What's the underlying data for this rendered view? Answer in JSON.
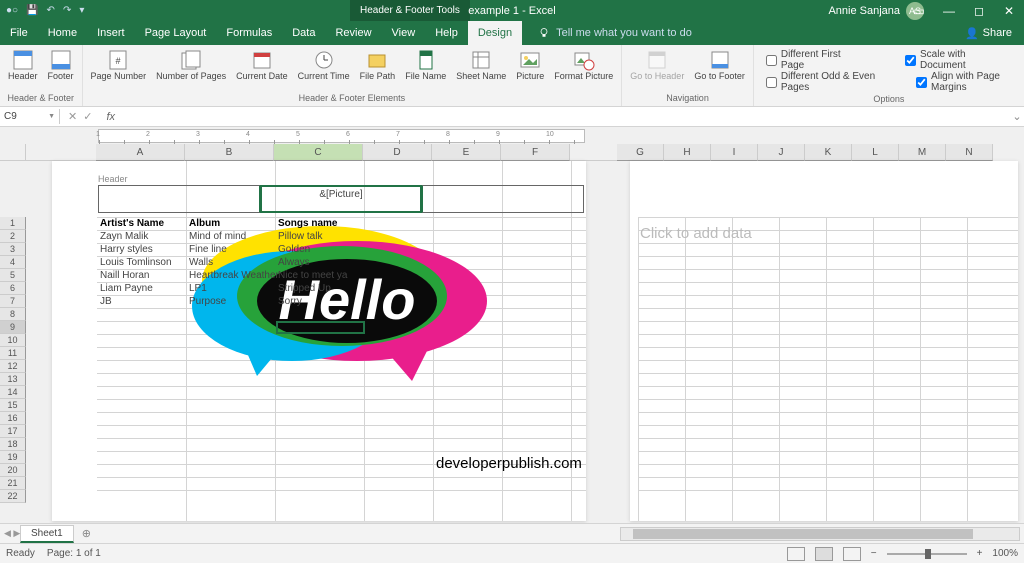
{
  "title": "example 1 - Excel",
  "contextual_tab": "Header & Footer Tools",
  "user": {
    "name": "Annie Sanjana",
    "initials": "AS"
  },
  "menu": [
    "File",
    "Home",
    "Insert",
    "Page Layout",
    "Formulas",
    "Data",
    "Review",
    "View",
    "Help",
    "Design"
  ],
  "active_menu": "Design",
  "tellme": "Tell me what you want to do",
  "share": "Share",
  "ribbon": {
    "g1": {
      "buttons": [
        "Header",
        "Footer"
      ],
      "label": "Header & Footer"
    },
    "g2": {
      "buttons": [
        "Page\nNumber",
        "Number\nof Pages",
        "Current\nDate",
        "Current\nTime",
        "File\nPath",
        "File\nName",
        "Sheet\nName",
        "Picture",
        "Format\nPicture"
      ],
      "label": "Header & Footer Elements"
    },
    "g3": {
      "buttons": [
        "Go to\nHeader",
        "Go to\nFooter"
      ],
      "label": "Navigation"
    },
    "options": {
      "diff_first": "Different First Page",
      "diff_oddeven": "Different Odd & Even Pages",
      "scale": "Scale with Document",
      "align": "Align with Page Margins",
      "label": "Options"
    }
  },
  "namebox": "C9",
  "fx_label": "fx",
  "cols_main": [
    "A",
    "B",
    "C",
    "D",
    "E",
    "F"
  ],
  "cols_page2": [
    "G",
    "H",
    "I",
    "J",
    "K",
    "L",
    "M",
    "N"
  ],
  "rows": [
    "1",
    "2",
    "3",
    "4",
    "5",
    "6",
    "7",
    "8",
    "9",
    "10",
    "11",
    "12",
    "13",
    "14",
    "15",
    "16",
    "17",
    "18",
    "19",
    "20",
    "21",
    "22"
  ],
  "header_label": "Header",
  "header_code": "&[Picture]",
  "table": {
    "headers": [
      "Artist's Name",
      "Album",
      "Songs name"
    ],
    "rows": [
      [
        "Zayn Malik",
        "Mind of mind",
        "Pillow talk"
      ],
      [
        "Harry styles",
        "Fine line",
        "Golden"
      ],
      [
        "Louis Tomlinson",
        "Walls",
        "Always"
      ],
      [
        "Naill Horan",
        "Heartbreak Weather",
        "Nice to meet ya"
      ],
      [
        "Liam Payne",
        "LP1",
        "Stripped Up"
      ],
      [
        "JB",
        "Purpose",
        "Sorry"
      ]
    ]
  },
  "click_to_add": "Click to add data",
  "watermark": "developerpublish.com",
  "sheet": "Sheet1",
  "status": {
    "ready": "Ready",
    "page": "Page: 1 of 1",
    "zoom": "100%"
  }
}
